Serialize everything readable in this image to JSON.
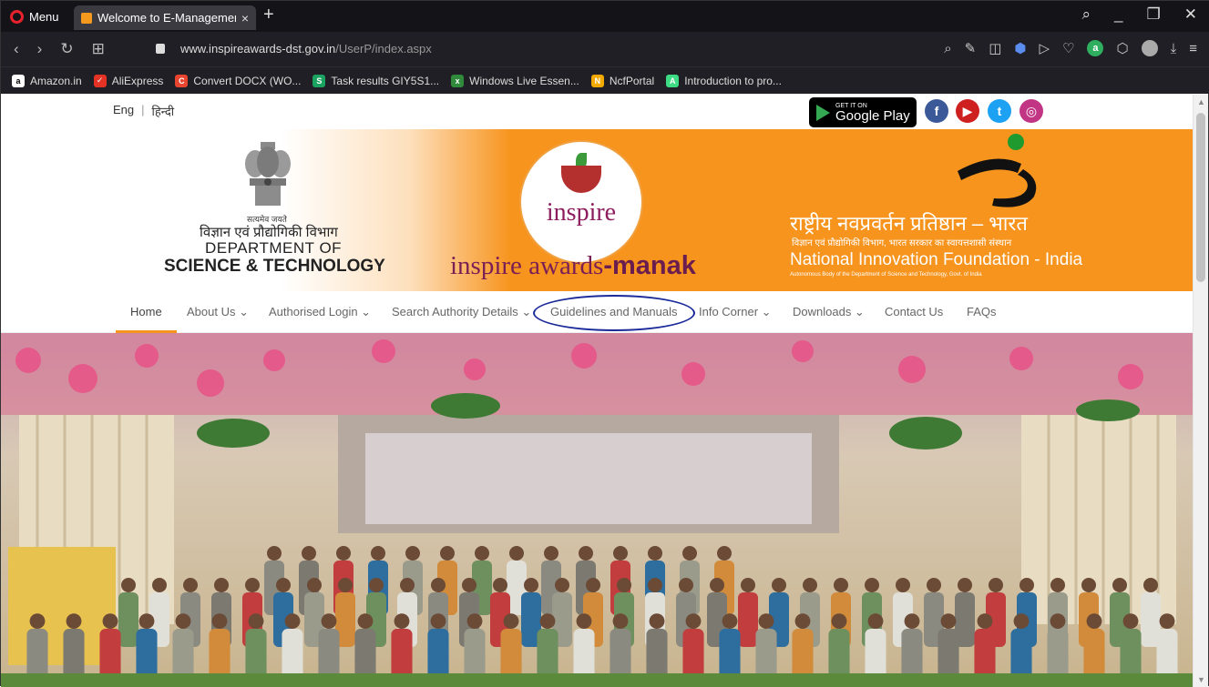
{
  "browser": {
    "menu_label": "Menu",
    "tab_title": "Welcome to E-Managemen",
    "tab_close": "×",
    "new_tab": "+",
    "url_host": "www.inspireawards-dst.gov.in",
    "url_path": "/UserP/index.aspx",
    "bookmarks": [
      {
        "label": "Amazon.in",
        "icon": "amazon-icon",
        "color": "#ffffff",
        "glyph": "a"
      },
      {
        "label": "AliExpress",
        "icon": "aliexpress-icon",
        "color": "#e43225",
        "glyph": "✓"
      },
      {
        "label": "Convert DOCX (WO...",
        "icon": "convert-icon",
        "color": "#e8442f",
        "glyph": "C"
      },
      {
        "label": "Task results GIY5S1...",
        "icon": "task-icon",
        "color": "#1aa260",
        "glyph": "S"
      },
      {
        "label": "Windows Live Essen...",
        "icon": "windows-live-icon",
        "color": "#2f8a3b",
        "glyph": "x"
      },
      {
        "label": "NcfPortal",
        "icon": "ncfportal-icon",
        "color": "#f2a900",
        "glyph": "N"
      },
      {
        "label": "Introduction to pro...",
        "icon": "android-icon",
        "color": "#3ddc84",
        "glyph": "A"
      }
    ]
  },
  "site": {
    "lang_eng": "Eng",
    "lang_sep": "|",
    "lang_hindi": "हिन्दी",
    "gplay_small": "GET IT ON",
    "gplay_big": "Google Play",
    "social": [
      {
        "name": "facebook-icon",
        "color": "#3b5998",
        "glyph": "f"
      },
      {
        "name": "youtube-icon",
        "color": "#cd201f",
        "glyph": "▶"
      },
      {
        "name": "twitter-icon",
        "color": "#1da1f2",
        "glyph": "t"
      },
      {
        "name": "instagram-icon",
        "color": "#c13584",
        "glyph": "◎"
      }
    ],
    "dst_motto": "सत्यमेव जयते",
    "dst_hindi": "विज्ञान एवं प्रौद्योगिकी विभाग",
    "dst_line1": "DEPARTMENT OF",
    "dst_line2": "SCIENCE & TECHNOLOGY",
    "inspire_word": "inspire",
    "awards_a": "inspire awards",
    "awards_b": "-manak",
    "nif_hindi": "राष्ट्रीय नवप्रवर्तन प्रतिष्ठान – भारत",
    "nif_sub": "विज्ञान एवं प्रौद्योगिकी विभाग, भारत सरकार का स्वायत्तशासी संस्थान",
    "nif_eng": "National Innovation Foundation - India",
    "nif_tiny": "Autonomous Body of the Department of Science and Technology, Govt. of India",
    "nav": {
      "home": "Home",
      "about": "About Us ⌄",
      "login": "Authorised Login ⌄",
      "search": "Search Authority Details ⌄",
      "guidelines": "Guidelines and Manuals",
      "info": "Info Corner ⌄",
      "downloads": "Downloads ⌄",
      "contact": "Contact Us",
      "faqs": "FAQs"
    }
  },
  "colors": {
    "banner_orange": "#f7941d",
    "inspire_purple": "#7a1f56",
    "annotation_blue": "#1b2a9a"
  }
}
